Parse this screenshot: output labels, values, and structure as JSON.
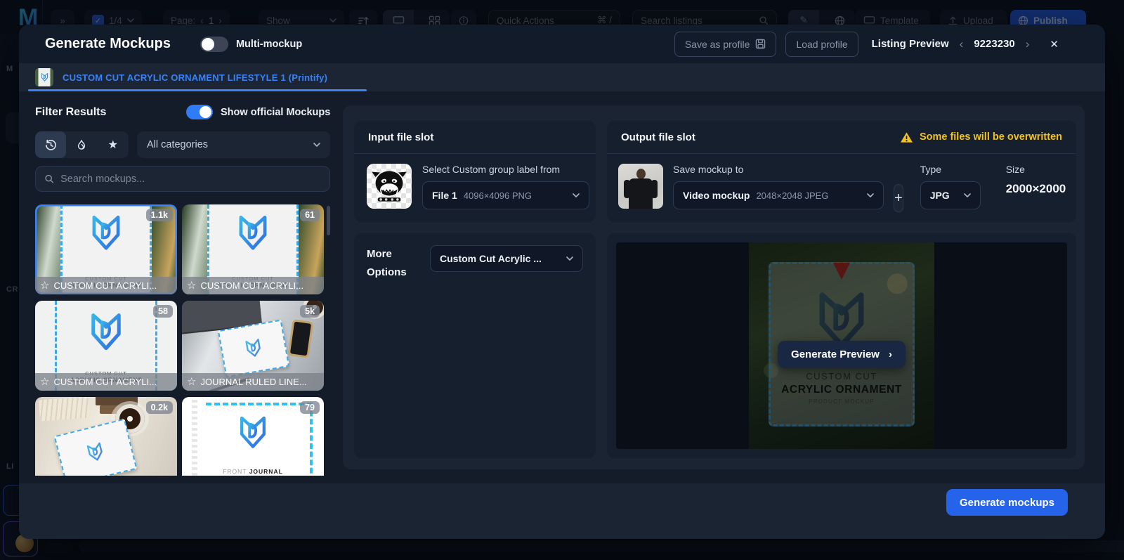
{
  "topbar": {
    "collapse": "»",
    "check_glyph": "✓",
    "check_label": "1/4",
    "page_label": "Page:",
    "page_prev": "‹",
    "page_value": "1",
    "page_next": "›",
    "show_label": "Show",
    "quick_actions_label": "Quick Actions",
    "quick_actions_shortcut": "⌘ /",
    "search_placeholder": "Search listings",
    "pencil_glyph": "✎",
    "template_label": "Template",
    "upload_label": "Upload",
    "publish_label": "Publish"
  },
  "sidebar": {
    "group1": "M",
    "group2": "CR",
    "group3": "LI"
  },
  "modal": {
    "title": "Generate Mockups",
    "multi_mockup_label": "Multi-mockup",
    "save_profile_label": "Save as profile",
    "load_profile_label": "Load profile",
    "listing_preview_label": "Listing Preview",
    "listing_prev": "‹",
    "listing_id": "9223230",
    "listing_next": "›",
    "close_glyph": "✕",
    "tab_label": "CUSTOM CUT ACRYLIC ORNAMENT LIFESTYLE 1 (Printify)",
    "filter": {
      "title": "Filter Results",
      "official_toggle_label": "Show official Mockups",
      "category_value": "All categories",
      "search_placeholder": "Search mockups...",
      "star_glyph": "★"
    },
    "thumbnails": [
      {
        "badge": "1.1k",
        "caption": "CUSTOM CUT ACRYLI...",
        "star": "☆"
      },
      {
        "badge": "61",
        "caption": "CUSTOM CUT ACRYLI...",
        "star": "☆"
      },
      {
        "badge": "58",
        "caption": "CUSTOM CUT ACRYLI...",
        "star": "☆"
      },
      {
        "badge": "5k",
        "caption": "JOURNAL RULED LINE...",
        "star": "☆"
      },
      {
        "badge": "0.2k"
      },
      {
        "badge": "79"
      }
    ],
    "mockup_art": {
      "line1": "CUSTOM CUT",
      "line2": "ACRYLIC ORNAMENT",
      "line3": "PRODUCT MOCKUP",
      "journal_front": "FRONT ",
      "journal_bold": "JOURNAL",
      "journal_sub": "PRODUCT MOCKUP"
    },
    "input_slot": {
      "title": "Input file slot",
      "select_label": "Select Custom group label from",
      "file_value": "File 1",
      "file_meta": "4096×4096 PNG",
      "more_options_label": "More Options",
      "more_options_value": "Custom Cut Acrylic ..."
    },
    "output_slot": {
      "title": "Output file slot",
      "warning": "Some files will be overwritten",
      "save_label": "Save mockup to",
      "target_value": "Video mockup",
      "target_meta": "2048×2048 JPEG",
      "add_label": "+",
      "type_label": "Type",
      "type_value": "JPG",
      "size_label": "Size",
      "size_value": "2000×2000",
      "preview_button": "Generate Preview",
      "preview_chev": "›"
    },
    "footer": {
      "generate_label": "Generate mockups"
    }
  },
  "colors": {
    "accent": "#3b82f6",
    "publish": "#2563eb",
    "warning": "#f2c21d"
  }
}
